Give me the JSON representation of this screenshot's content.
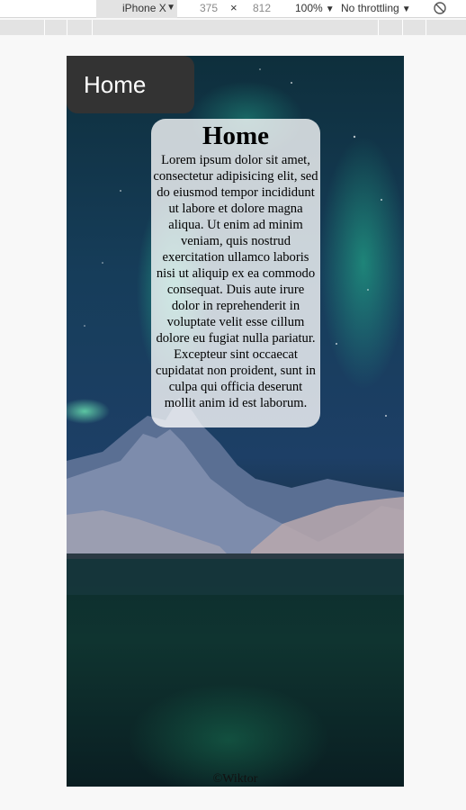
{
  "devtools": {
    "device": "iPhone X",
    "width": "375",
    "times": "×",
    "height": "812",
    "zoom": "100%",
    "throttling": "No throttling"
  },
  "nav": {
    "home_label": "Home"
  },
  "card": {
    "title": "Home",
    "body": "Lorem ipsum dolor sit amet, consectetur adipisicing elit, sed do eiusmod tempor incididunt ut labore et dolore magna aliqua. Ut enim ad minim veniam, quis nostrud exercitation ullamco laboris nisi ut aliquip ex ea commodo consequat. Duis aute irure dolor in reprehenderit in voluptate velit esse cillum dolore eu fugiat nulla pariatur. Excepteur sint occaecat cupidatat non proident, sunt in culpa qui officia deserunt mollit anim id est laborum."
  },
  "footer": {
    "text": "©Wiktor"
  },
  "icons": {
    "rotate": "rotate-icon",
    "caret": "caret-down-icon"
  },
  "colors": {
    "tab_bg": "#333333",
    "card_bg": "rgba(255,255,255,0.78)"
  }
}
